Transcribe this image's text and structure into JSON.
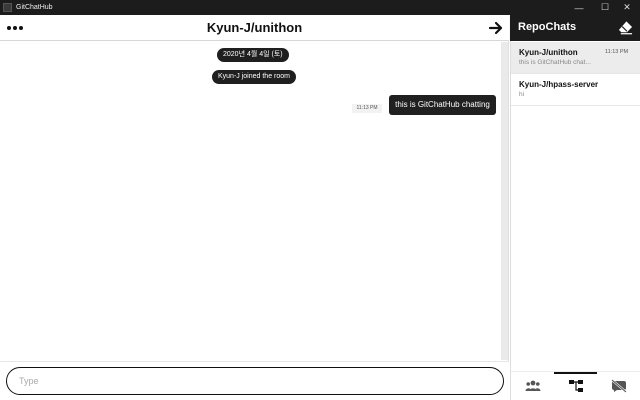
{
  "window": {
    "title": "GitChatHub",
    "minimize_label": "—",
    "maximize_label": "☐",
    "close_label": "✕"
  },
  "chat": {
    "room_title": "Kyun-J/unithon",
    "date_label": "2020년 4월 4일 (토)",
    "system_message": "Kyun-J joined the room",
    "messages": [
      {
        "text": "this is GitChatHub chatting",
        "time": "11:13 PM"
      }
    ],
    "input": {
      "value": "",
      "placeholder": "Type"
    }
  },
  "sidebar": {
    "title": "RepoChats",
    "rooms": [
      {
        "name": "Kyun-J/unithon",
        "time": "11:13 PM",
        "preview": "this is GitChatHub chat..."
      },
      {
        "name": "Kyun-J/hpass-server",
        "time": "",
        "preview": "hi"
      }
    ],
    "tabs": [
      {
        "icon": "people-icon"
      },
      {
        "icon": "repo-tree-icon"
      },
      {
        "icon": "hidden-chat-icon"
      }
    ],
    "active_tab": 1
  },
  "colors": {
    "dark": "#1c1c1c",
    "bubble": "#202020",
    "active_room": "#ececec",
    "accent_text": "#ffffff"
  }
}
